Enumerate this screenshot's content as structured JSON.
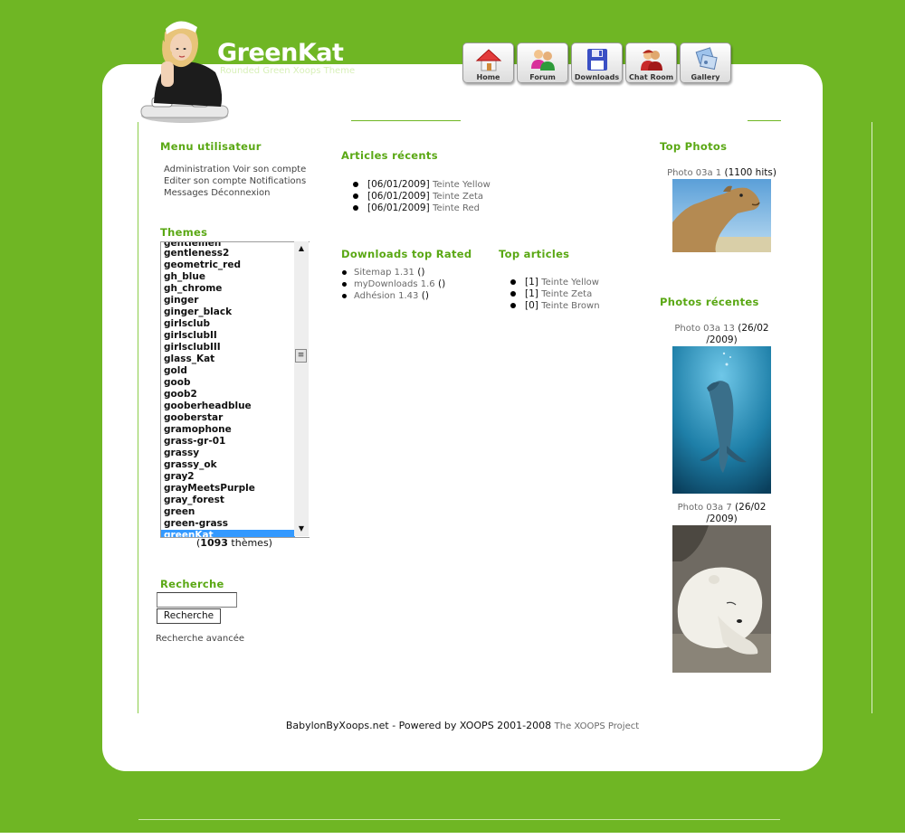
{
  "header": {
    "site_name": "GreenKat",
    "slogan": "Rounded Green Xoops Theme"
  },
  "nav": [
    {
      "label": "Home",
      "icon": "house-icon"
    },
    {
      "label": "Forum",
      "icon": "users-icon"
    },
    {
      "label": "Downloads",
      "icon": "floppy-disk-icon"
    },
    {
      "label": "Chat Room",
      "icon": "chat-people-icon"
    },
    {
      "label": "Gallery",
      "icon": "gallery-icon"
    }
  ],
  "user_menu": {
    "title": "Menu utilisateur",
    "links": [
      "Administration",
      "Voir son compte",
      "Editer son compte",
      "Notifications",
      "Messages",
      "Déconnexion"
    ]
  },
  "themes": {
    "title": "Themes",
    "partial_top": "gentlemen",
    "items": [
      "gentleness2",
      "geometric_red",
      "gh_blue",
      "gh_chrome",
      "ginger",
      "ginger_black",
      "girlsclub",
      "girlsclubII",
      "girlsclubIII",
      "glass_Kat",
      "gold",
      "goob",
      "goob2",
      "gooberheadblue",
      "gooberstar",
      "gramophone",
      "grass-gr-01",
      "grassy",
      "grassy_ok",
      "gray2",
      "grayMeetsPurple",
      "gray_forest",
      "green",
      "green-grass",
      "greenKat"
    ],
    "selected": "greenKat",
    "count_open": "(",
    "count": "1093",
    "count_suffix": " thèmes)"
  },
  "search": {
    "title": "Recherche",
    "input_value": "",
    "button_label": "Recherche",
    "advanced_label": "Recherche avancée"
  },
  "recent_articles": {
    "title": "Articles récents",
    "items": [
      {
        "date": "[06/01/2009]",
        "title": "Teinte Yellow"
      },
      {
        "date": "[06/01/2009]",
        "title": "Teinte Zeta"
      },
      {
        "date": "[06/01/2009]",
        "title": "Teinte Red"
      }
    ]
  },
  "downloads_top_rated": {
    "title": "Downloads top Rated",
    "items": [
      {
        "name": "Sitemap 1.31",
        "rating": "()"
      },
      {
        "name": "myDownloads 1.6",
        "rating": "()"
      },
      {
        "name": "Adhésion 1.43",
        "rating": "()"
      }
    ]
  },
  "top_articles": {
    "title": "Top articles",
    "items": [
      {
        "count": "[1]",
        "title": "Teinte Yellow"
      },
      {
        "count": "[1]",
        "title": "Teinte Zeta"
      },
      {
        "count": "[0]",
        "title": "Teinte Brown"
      }
    ]
  },
  "top_photos": {
    "title": "Top Photos",
    "items": [
      {
        "name": "Photo 03a 1",
        "info": "(1100 hits)"
      }
    ]
  },
  "recent_photos": {
    "title": "Photos récentes",
    "items": [
      {
        "name": "Photo 03a 13",
        "info_a": "(26/02",
        "info_b": "/2009)"
      },
      {
        "name": "Photo 03a 7",
        "info_a": "(26/02",
        "info_b": "/2009)"
      }
    ]
  },
  "footer": {
    "text": "BabylonByXoops.net - Powered by XOOPS 2001-2008",
    "link": "The XOOPS Project"
  },
  "colors": {
    "background": "#6fb624",
    "block_title": "#5aa814",
    "selected_item": "#3399ff"
  }
}
